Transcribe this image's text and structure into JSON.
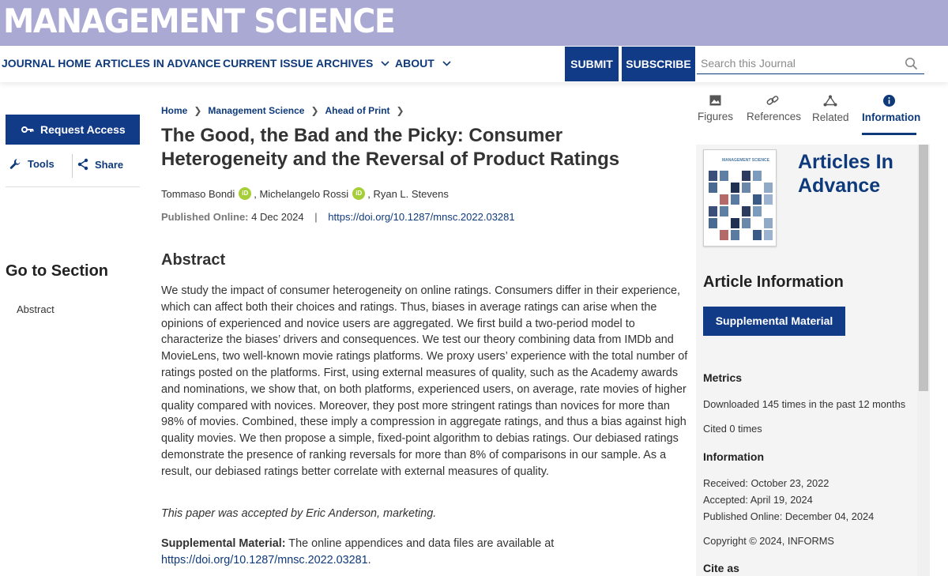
{
  "header": {
    "journal_name": "MANAGEMENT SCIENCE"
  },
  "nav": {
    "items": [
      "JOURNAL HOME",
      "ARTICLES IN ADVANCE",
      "CURRENT ISSUE",
      "ARCHIVES",
      "ABOUT"
    ],
    "submit_label": "SUBMIT",
    "subscribe_label": "SUBSCRIBE",
    "search_placeholder": "Search this Journal"
  },
  "left": {
    "request_access": "Request Access",
    "tools": "Tools",
    "share": "Share",
    "goto_heading": "Go to Section",
    "sections": [
      "Abstract"
    ]
  },
  "article": {
    "breadcrumb": [
      "Home",
      "Management Science",
      "Ahead of Print"
    ],
    "title": "The Good, the Bad and the Picky: Consumer Heterogeneity and the Reversal of Product Ratings",
    "authors": [
      "Tommaso Bondi",
      "Michelangelo Rossi",
      "Ryan L. Stevens"
    ],
    "orcid_badge": "iD",
    "author_sep": ",",
    "published_label": "Published Online:",
    "published_date": "4 Dec 2024",
    "doi": "https://doi.org/10.1287/mnsc.2022.03281",
    "abstract_heading": "Abstract",
    "abstract": "We study the impact of consumer heterogeneity on online ratings. Consumers differ in their experience, which can affect both their choices and ratings. Thus, biases in average ratings can arise when the opinions of experienced and novice users are aggregated. We first build a two-period model to characterize the biases’ drivers and consequences. We test our theory combining data from IMDb and MovieLens, two well-known movie ratings platforms. We proxy users’ experience with the total number of ratings posted on the platforms. First, using external measures of quality, such as the Academy awards and nominations, we show that, on both platforms, experienced users, on average, rate movies of higher quality compared with novices. Moreover, they post more stringent ratings than novices for more than 98% of movies. Combined, these imply a compression in aggregate ratings, and thus a bias against high quality movies. We then propose a simple, fixed-point algorithm to debias ratings. Our debiased ratings demonstrate the presence of ranking reversals for more than 8% of comparisons in our sample. As a result, our debiased ratings better correlate with external measures of quality.",
    "accepted_note": "This paper was accepted by Eric Anderson, marketing.",
    "supp_label": "Supplemental Material:",
    "supp_text": "The online appendices and data files are available at",
    "supp_link": "https://doi.org/10.1287/mnsc.2022.03281",
    "supp_end": "."
  },
  "right": {
    "tabs": [
      "Figures",
      "References",
      "Related",
      "Information"
    ],
    "active_tab": "Information",
    "articles_in_advance": "Articles In Advance",
    "cover_text": "MANAGEMENT SCIENCE",
    "article_info_heading": "Article Information",
    "supplemental_button": "Supplemental Material",
    "metrics_heading": "Metrics",
    "downloads": "Downloaded 145 times in the past 12 months",
    "cited": "Cited 0 times",
    "information_heading": "Information",
    "received": "Received: October 23, 2022",
    "accepted": "Accepted: April 19, 2024",
    "published": "Published Online: December 04, 2024",
    "copyright": "Copyright © 2024, INFORMS",
    "cite_as": "Cite as"
  },
  "colors": {
    "banner": "#aaa9d3",
    "brand_blue": "#123b87",
    "link_blue": "#0e3a7c",
    "orcid_green": "#a6ce39",
    "panel_bg": "#f4f4f4"
  }
}
